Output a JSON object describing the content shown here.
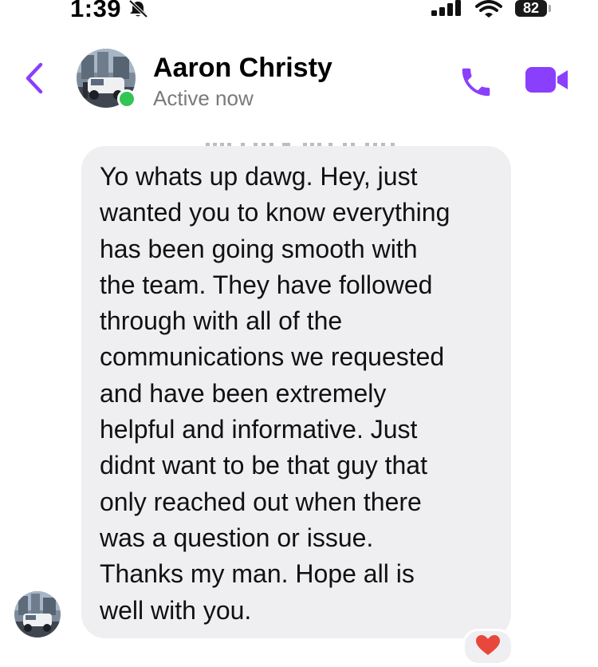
{
  "status_bar": {
    "time": "1:39",
    "battery": "82",
    "icons": [
      "bell-slash-icon",
      "signal-bars-icon",
      "wifi-icon",
      "battery-icon"
    ]
  },
  "header": {
    "back_icon": "chevron-left-icon",
    "contact_name": "Aaron Christy",
    "status": "Active now",
    "call_icon": "phone-icon",
    "video_icon": "video-camera-icon"
  },
  "message": {
    "text": "Yo whats up dawg. Hey, just\nwanted you to know everything\nhas been going smooth with\nthe team. They have followed\nthrough with all of the\ncommunications we requested\nand have been extremely\nhelpful and informative. Just\ndidnt want to be that guy that\nonly reached out when there\nwas a question or issue.\nThanks my man. Hope all is\nwell with you.",
    "reaction": "heart"
  },
  "colors": {
    "accent": "#8a3ffc",
    "bubble": "#efeff1",
    "online": "#31c553"
  }
}
